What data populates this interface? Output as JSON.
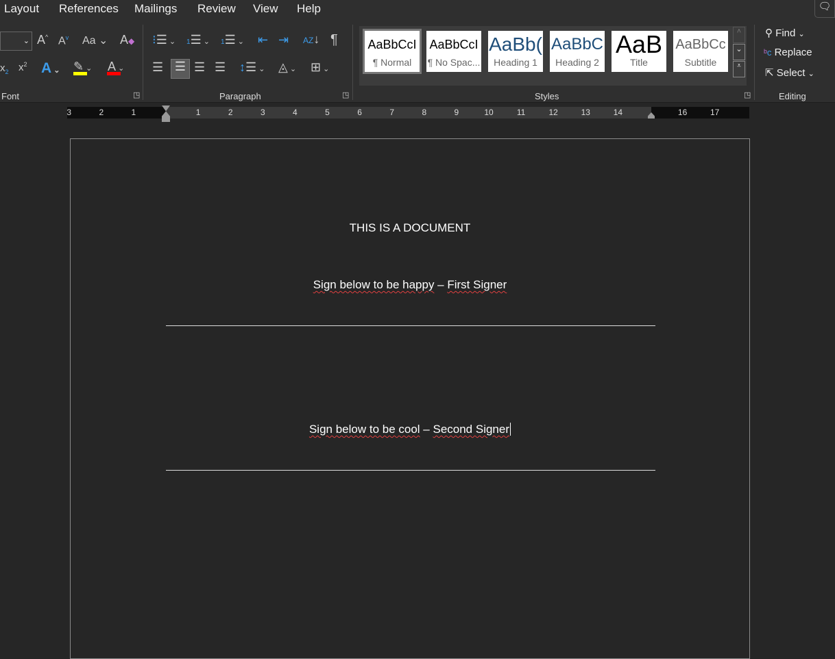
{
  "menu": [
    "Layout",
    "References",
    "Mailings",
    "Review",
    "View",
    "Help"
  ],
  "groups": {
    "font": "Font",
    "paragraph": "Paragraph",
    "styles": "Styles",
    "editing": "Editing"
  },
  "font_tools": {
    "case": "Aa"
  },
  "styles": [
    {
      "preview": "AaBbCcI",
      "label": "¶ Normal",
      "color": "#000000",
      "size": 18
    },
    {
      "preview": "AaBbCcI",
      "label": "¶ No Spac...",
      "color": "#000000",
      "size": 18
    },
    {
      "preview": "AaBb(",
      "label": "Heading 1",
      "color": "#1f4e79",
      "size": 28
    },
    {
      "preview": "AaBbC",
      "label": "Heading 2",
      "color": "#1f4e79",
      "size": 24
    },
    {
      "preview": "AaB",
      "label": "Title",
      "color": "#000000",
      "size": 36
    },
    {
      "preview": "AaBbCc",
      "label": "Subtitle",
      "color": "#666666",
      "size": 20
    }
  ],
  "editing": {
    "find": "Find",
    "replace": "Replace",
    "select": "Select"
  },
  "ruler": {
    "left": [
      "3",
      "2",
      "1"
    ],
    "right": [
      "1",
      "2",
      "3",
      "4",
      "5",
      "6",
      "7",
      "8",
      "9",
      "10",
      "11",
      "12",
      "13",
      "14",
      "16",
      "17"
    ]
  },
  "document": {
    "title": "THIS IS A DOCUMENT",
    "sign1_a": "Sign below to be happy",
    "sign1_b": " – ",
    "sign1_c": "First Signer",
    "sign2_a": "Sign below to be cool",
    "sign2_b": " – ",
    "sign2_c": "Second Signer"
  },
  "colors": {
    "highlight": "#ffff00",
    "font_color": "#ff0000",
    "accent": "#3d9be9"
  }
}
